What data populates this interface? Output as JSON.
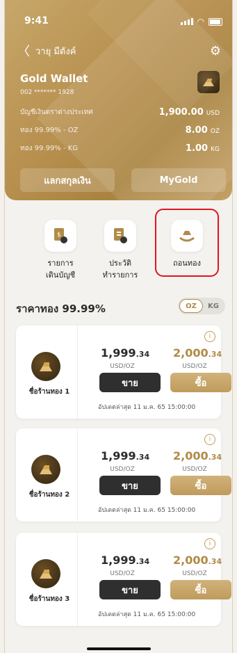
{
  "status": {
    "time": "9:41"
  },
  "nav": {
    "back": "〈",
    "title": "วายุ มีตังค์"
  },
  "wallet": {
    "title": "Gold Wallet",
    "account": "002 ******* 1928",
    "rows": [
      {
        "label": "บัญชีเงินตราต่างประเทศ",
        "value": "1,900.00",
        "unit": "USD"
      },
      {
        "label": "ทอง 99.99% - OZ",
        "value": "8.00",
        "unit": "OZ"
      },
      {
        "label": "ทอง 99.99% - KG",
        "value": "1.00",
        "unit": "KG"
      }
    ],
    "buttons": {
      "exchange": "แลกสกุลเงิน",
      "mygold": "MyGold"
    }
  },
  "actions": [
    {
      "label": "รายการ\nเดินบัญชี"
    },
    {
      "label": "ประวัติ\nทำรายการ"
    },
    {
      "label": "ถอนทอง"
    }
  ],
  "gold_price": {
    "title": "ราคาทอง 99.99%",
    "toggle": {
      "active": "OZ",
      "inactive": "KG"
    }
  },
  "shops": [
    {
      "name": "ชื่อร้านทอง 1",
      "sell_int": "1,999",
      "sell_dec": ".34",
      "buy_int": "2,000",
      "buy_dec": ".34",
      "unit": "USD/OZ",
      "sell_label": "ขาย",
      "buy_label": "ซื้อ",
      "updated": "อัปเดตล่าสุด 11 ม.ค. 65 15:00:00"
    },
    {
      "name": "ชื่อร้านทอง 2",
      "sell_int": "1,999",
      "sell_dec": ".34",
      "buy_int": "2,000",
      "buy_dec": ".34",
      "unit": "USD/OZ",
      "sell_label": "ขาย",
      "buy_label": "ซื้อ",
      "updated": "อัปเดตล่าสุด 11 ม.ค. 65 15:00:00"
    },
    {
      "name": "ชื่อร้านทอง 3",
      "sell_int": "1,999",
      "sell_dec": ".34",
      "buy_int": "2,000",
      "buy_dec": ".34",
      "unit": "USD/OZ",
      "sell_label": "ขาย",
      "buy_label": "ซื้อ",
      "updated": "อัปเดตล่าสุด 11 ม.ค. 65 15:00:00"
    }
  ],
  "colors": {
    "gold": "#b08a47",
    "dark": "#2f2f2f",
    "highlight": "#e0141c"
  }
}
